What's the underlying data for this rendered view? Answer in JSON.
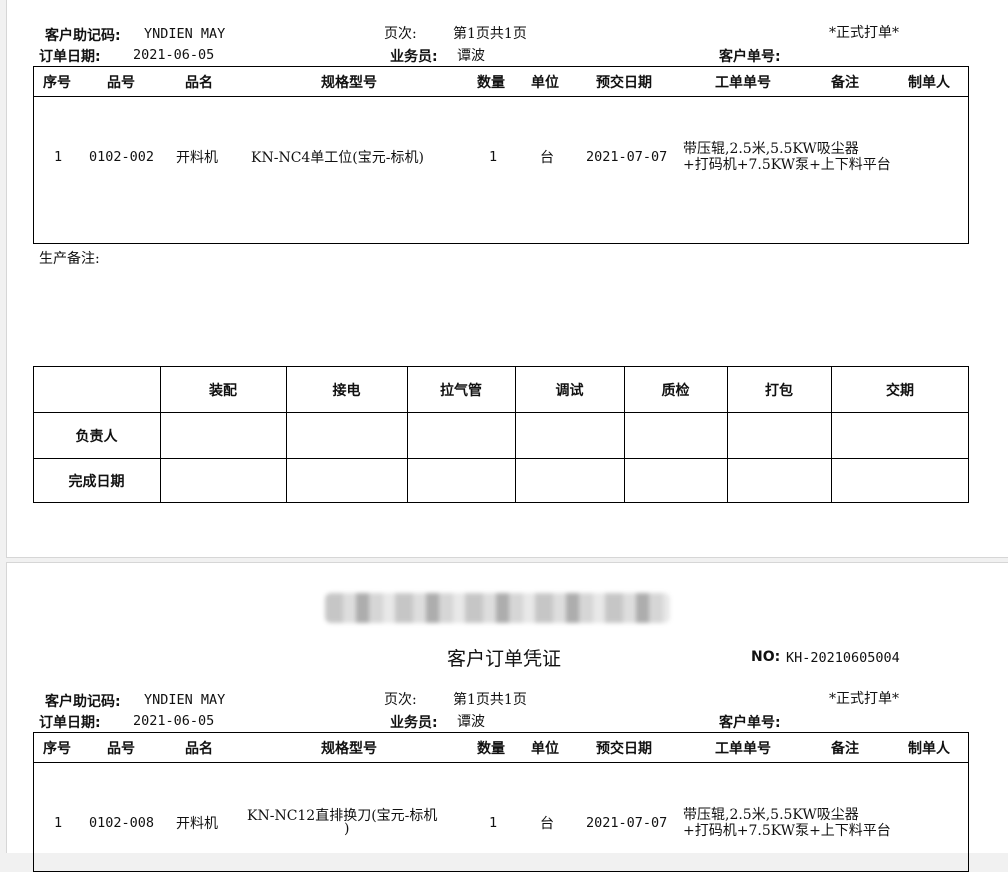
{
  "header": {
    "customer_code_label": "客户助记码:",
    "customer_code": "YNDIEN MAY",
    "page_label": "页次:",
    "page_value": "第1页共1页",
    "formal": "*正式打单*",
    "order_date_label": "订单日期:",
    "order_date": "2021-06-05",
    "salesman_label": "业务员:",
    "salesman": "谭波",
    "customer_no_label": "客户单号:",
    "customer_no": ""
  },
  "columns": [
    "序号",
    "品号",
    "品名",
    "规格型号",
    "数量",
    "单位",
    "预交日期",
    "工单单号",
    "备注",
    "制单人"
  ],
  "page1": {
    "rows": [
      {
        "seq": "1",
        "code": "0102-002",
        "name": "开料机",
        "spec": "KN-NC4单工位(宝元-标机)",
        "qty": "1",
        "unit": "台",
        "due": "2021-07-07",
        "workorder_line1": "带压辊,2.5米,5.5KW吸尘器",
        "workorder_line2": "+打码机+7.5KW泵+上下料平台"
      }
    ],
    "production_note_label": "生产备注:"
  },
  "process_table": {
    "columns": [
      "装配",
      "接电",
      "拉气管",
      "调试",
      "质检",
      "打包",
      "交期"
    ],
    "row_labels": [
      "负责人",
      "完成日期"
    ]
  },
  "page2": {
    "title": "客户订单凭证",
    "no_label": "NO:",
    "no_value": "KH-20210605004",
    "rows": [
      {
        "seq": "1",
        "code": "0102-008",
        "name": "开料机",
        "spec_line1": "KN-NC12直排换刀(宝元-标机",
        "spec_line2": ")",
        "qty": "1",
        "unit": "台",
        "due": "2021-07-07",
        "workorder_line1": "带压辊,2.5米,5.5KW吸尘器",
        "workorder_line2": "+打码机+7.5KW泵+上下料平台"
      }
    ]
  }
}
